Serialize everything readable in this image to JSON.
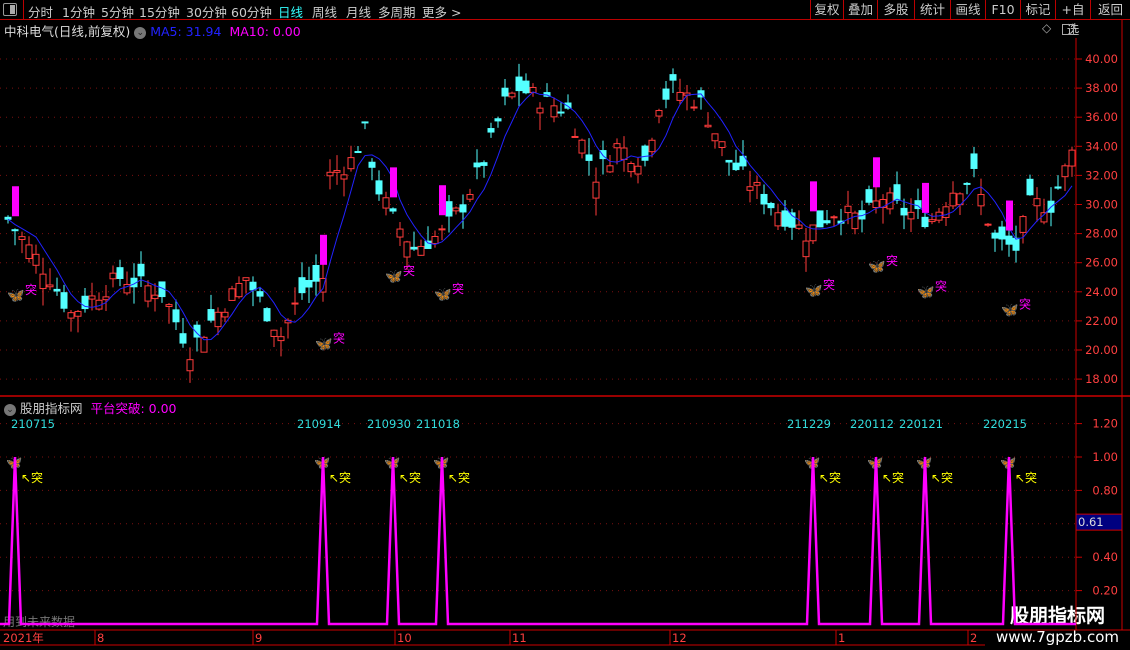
{
  "toolbar": {
    "left": [
      "分时",
      "1分钟",
      "5分钟",
      "15分钟",
      "30分钟",
      "60分钟",
      "日线",
      "周线",
      "月线",
      "多周期",
      "更多 >"
    ],
    "active": "日线",
    "right": [
      "复权",
      "叠加",
      "多股",
      "统计",
      "画线",
      "F10",
      "标记",
      "+自选",
      "返回"
    ]
  },
  "main": {
    "title": "中科电气(日线,前复权)",
    "ma5": "MA5: 31.94",
    "ma10": "MA10: 0.00",
    "y_ticks": [
      "40.00",
      "38.00",
      "36.00",
      "34.00",
      "32.00",
      "30.00",
      "28.00",
      "26.00",
      "24.00",
      "22.00",
      "20.00",
      "18.00"
    ],
    "signal_label": "突"
  },
  "indicator": {
    "source": "股朋指标网",
    "name": "平台突破: 0.00",
    "y_ticks": [
      "1.20",
      "1.00",
      "0.80",
      "0.60",
      "0.40",
      "0.20"
    ],
    "current_value": "0.61",
    "signal_label": "↖突",
    "dates": [
      "210715",
      "210914",
      "210930",
      "211018",
      "211229",
      "220112",
      "220121",
      "220215"
    ],
    "footer_text": "用到未来数据"
  },
  "x_axis": {
    "labels": [
      "2021年",
      "8",
      "9",
      "10",
      "11",
      "12",
      "1",
      "2"
    ]
  },
  "watermark": {
    "line1": "股朋指标网",
    "line2": "www.7gpzb.com"
  },
  "colors": {
    "up": "#ff3b3b",
    "down": "#54ffff",
    "ma5": "#2222ff",
    "signal": "#ff00ff",
    "axis": "#cc0000",
    "text_cyan": "#33dddd"
  },
  "chart_data": {
    "type": "candlestick",
    "ylim": [
      17,
      41
    ],
    "anchors_close": [
      [
        0,
        29
      ],
      [
        6,
        25
      ],
      [
        9,
        22.5
      ],
      [
        16,
        25
      ],
      [
        22,
        24
      ],
      [
        26,
        20
      ],
      [
        29,
        22
      ],
      [
        34,
        25
      ],
      [
        39,
        21
      ],
      [
        42,
        24
      ],
      [
        45,
        25
      ],
      [
        46,
        32
      ],
      [
        49,
        33
      ],
      [
        51,
        35
      ],
      [
        53,
        31
      ],
      [
        55,
        29
      ],
      [
        58,
        27
      ],
      [
        62,
        28
      ],
      [
        65,
        30
      ],
      [
        68,
        33
      ],
      [
        71,
        37
      ],
      [
        73,
        38
      ],
      [
        77,
        37
      ],
      [
        80,
        36.5
      ],
      [
        84,
        32
      ],
      [
        87,
        34
      ],
      [
        91,
        33
      ],
      [
        93,
        37
      ],
      [
        95,
        38
      ],
      [
        99,
        37
      ],
      [
        103,
        33
      ],
      [
        109,
        30
      ],
      [
        114,
        28
      ],
      [
        118,
        29.5
      ],
      [
        122,
        29
      ],
      [
        125,
        30.5
      ],
      [
        128,
        29.5
      ],
      [
        132,
        29
      ],
      [
        135,
        31
      ],
      [
        138,
        32
      ],
      [
        141,
        27.5
      ],
      [
        144,
        27
      ],
      [
        146,
        30
      ],
      [
        149,
        30
      ],
      [
        152,
        33.5
      ]
    ],
    "signal_bars": [
      1,
      45,
      55,
      62,
      115,
      124,
      131,
      143
    ],
    "signal_value": 1.0
  }
}
